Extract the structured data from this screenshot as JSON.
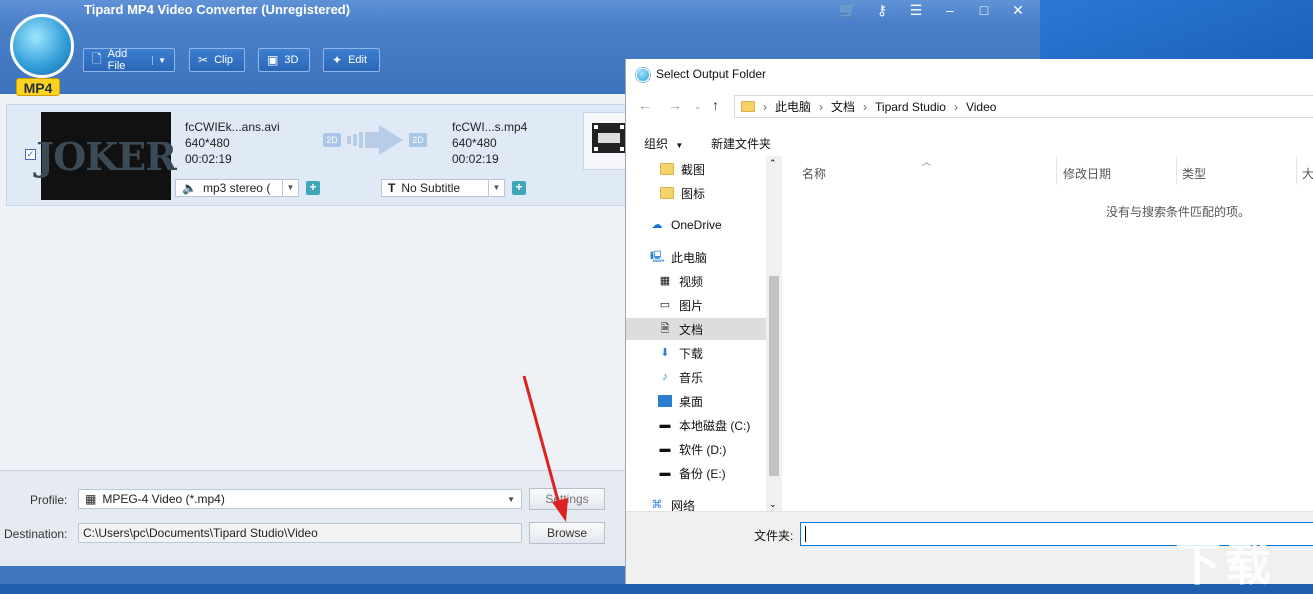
{
  "app": {
    "title": "Tipard MP4 Video Converter (Unregistered)",
    "logo_text": "MP4"
  },
  "toolbar": {
    "add_file": "Add File",
    "clip": "Clip",
    "three_d": "3D",
    "edit": "Edit"
  },
  "file": {
    "source_name": "fcCWIEk...ans.avi",
    "source_res": "640*480",
    "source_dur": "00:02:19",
    "badge_in": "2D",
    "badge_out": "2D",
    "output_name": "fcCWI...s.mp4",
    "output_res": "640*480",
    "output_dur": "00:02:19",
    "audio": "mp3 stereo (",
    "subtitle": "No Subtitle",
    "thumb_text": "JOKER"
  },
  "bottom": {
    "profile_label": "Profile:",
    "profile_value": "MPEG-4 Video (*.mp4)",
    "settings": "Settings",
    "destination_label": "Destination:",
    "destination_value": "C:\\Users\\pc\\Documents\\Tipard Studio\\Video",
    "browse": "Browse"
  },
  "dialog": {
    "title": "Select Output Folder",
    "breadcrumb": [
      "此电脑",
      "文档",
      "Tipard Studio",
      "Video"
    ],
    "organize": "组织",
    "new_folder": "新建文件夹",
    "nav_items": [
      {
        "label": "截图",
        "icon": "folder-icon"
      },
      {
        "label": "图标",
        "icon": "folder-icon"
      },
      {
        "label": "OneDrive",
        "icon": "cloud-icon"
      },
      {
        "label": "此电脑",
        "icon": "computer-icon"
      },
      {
        "label": "视频",
        "icon": "video-icon"
      },
      {
        "label": "图片",
        "icon": "picture-icon"
      },
      {
        "label": "文档",
        "icon": "document-icon"
      },
      {
        "label": "下载",
        "icon": "download-icon"
      },
      {
        "label": "音乐",
        "icon": "music-icon"
      },
      {
        "label": "桌面",
        "icon": "desktop-icon"
      },
      {
        "label": "本地磁盘 (C:)",
        "icon": "drive-icon"
      },
      {
        "label": "软件 (D:)",
        "icon": "drive-icon"
      },
      {
        "label": "备份 (E:)",
        "icon": "drive-icon"
      },
      {
        "label": "网络",
        "icon": "network-icon"
      }
    ],
    "columns": [
      "名称",
      "修改日期",
      "类型",
      "大"
    ],
    "empty_message": "没有与搜索条件匹配的项。",
    "folder_label": "文件夹:",
    "folder_value": ""
  },
  "watermark": "下载"
}
